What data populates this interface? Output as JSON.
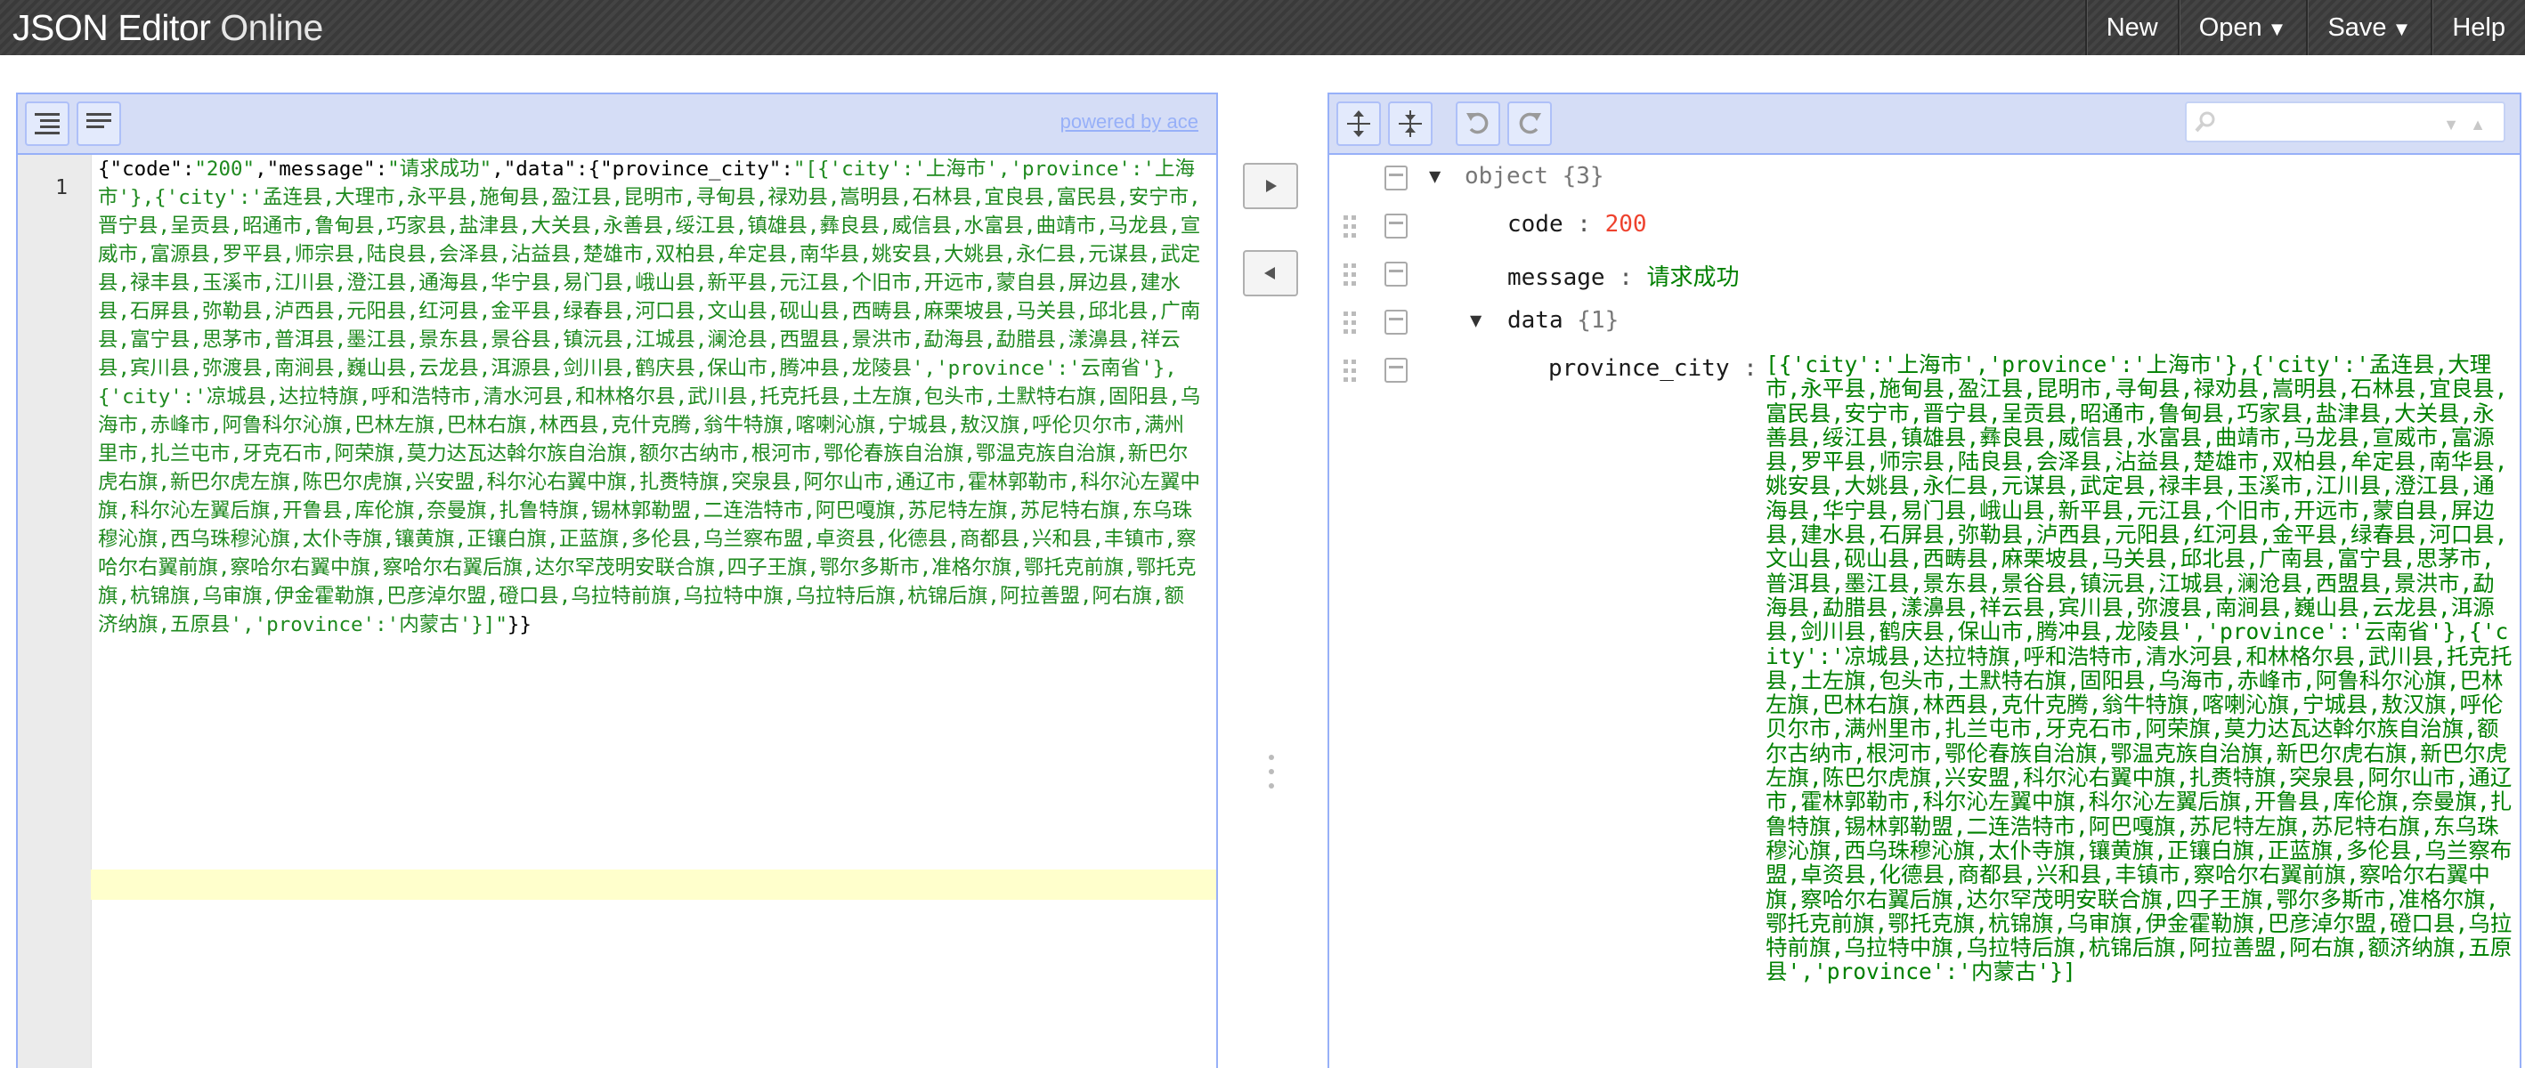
{
  "header": {
    "logo_bold": "JSON Editor",
    "logo_light": "Online",
    "menu": [
      {
        "label": "New",
        "caret": ""
      },
      {
        "label": "Open",
        "caret": "▼"
      },
      {
        "label": "Save",
        "caret": "▼"
      },
      {
        "label": "Help",
        "caret": ""
      }
    ]
  },
  "code_panel": {
    "powered_by": "powered by ace",
    "line_number": "1",
    "code": {
      "t01": "{",
      "t02": "\"code\"",
      "t03": ":",
      "t04": "\"200\"",
      "t05": ",",
      "t06": "\"message\"",
      "t07": ":",
      "t08": "\"请求成功\"",
      "t09": ",",
      "t10": "\"data\"",
      "t11": ":{",
      "t12": "\"province_city\"",
      "t13": ":",
      "t14": "\"[{'city':'上海市','province':'上海市'},{'city':'孟连县,大理市,永平县,施甸县,盈江县,昆明市,寻甸县,禄劝县,嵩明县,石林县,宜良县,富民县,安宁市,晋宁县,呈贡县,昭通市,鲁甸县,巧家县,盐津县,大关县,永善县,绥江县,镇雄县,彝良县,威信县,水富县,曲靖市,马龙县,宣威市,富源县,罗平县,师宗县,陆良县,会泽县,沾益县,楚雄市,双柏县,牟定县,南华县,姚安县,大姚县,永仁县,元谋县,武定县,禄丰县,玉溪市,江川县,澄江县,通海县,华宁县,易门县,峨山县,新平县,元江县,个旧市,开远市,蒙自县,屏边县,建水县,石屏县,弥勒县,泸西县,元阳县,红河县,金平县,绿春县,河口县,文山县,砚山县,西畴县,麻栗坡县,马关县,邱北县,广南县,富宁县,思茅市,普洱县,墨江县,景东县,景谷县,镇沅县,江城县,澜沧县,西盟县,景洪市,勐海县,勐腊县,漾濞县,祥云县,宾川县,弥渡县,南涧县,巍山县,云龙县,洱源县,剑川县,鹤庆县,保山市,腾冲县,龙陵县','province':'云南省'},{'city':'凉城县,达拉特旗,呼和浩特市,清水河县,和林格尔县,武川县,托克托县,土左旗,包头市,土默特右旗,固阳县,乌海市,赤峰市,阿鲁科尔沁旗,巴林左旗,巴林右旗,林西县,克什克腾,翁牛特旗,喀喇沁旗,宁城县,敖汉旗,呼伦贝尔市,满州里市,扎兰屯市,牙克石市,阿荣旗,莫力达瓦达斡尔族自治旗,额尔古纳市,根河市,鄂伦春族自治旗,鄂温克族自治旗,新巴尔虎右旗,新巴尔虎左旗,陈巴尔虎旗,兴安盟,科尔沁右翼中旗,扎赉特旗,突泉县,阿尔山市,通辽市,霍林郭勒市,科尔沁左翼中旗,科尔沁左翼后旗,开鲁县,库伦旗,奈曼旗,扎鲁特旗,锡林郭勒盟,二连浩特市,阿巴嘎旗,苏尼特左旗,苏尼特右旗,东乌珠穆沁旗,西乌珠穆沁旗,太仆寺旗,镶黄旗,正镶白旗,正蓝旗,多伦县,乌兰察布盟,卓资县,化德县,商都县,兴和县,丰镇市,察哈尔右翼前旗,察哈尔右翼中旗,察哈尔右翼后旗,达尔罕茂明安联合旗,四子王旗,鄂尔多斯市,准格尔旗,鄂托克前旗,鄂托克旗,杭锦旗,乌审旗,伊金霍勒旗,巴彦淖尔盟,磴口县,乌拉特前旗,乌拉特中旗,乌拉特后旗,杭锦后旗,阿拉善盟,阿右旗,额济纳旗,五原县','province':'内蒙古'}]\"",
      "t15": "}}"
    }
  },
  "tree_panel": {
    "root_label": "object",
    "root_count": "{3}",
    "fields": {
      "code_key": "code",
      "code_value": "200",
      "message_key": "message",
      "message_value": "请求成功",
      "data_key": "data",
      "data_count": "{1}",
      "pc_key": "province_city",
      "pc_value": "[{'city':'上海市','province':'上海市'},{'city':'孟连县,大理市,永平县,施甸县,盈江县,昆明市,寻甸县,禄劝县,嵩明县,石林县,宜良县,富民县,安宁市,晋宁县,呈贡县,昭通市,鲁甸县,巧家县,盐津县,大关县,永善县,绥江县,镇雄县,彝良县,威信县,水富县,曲靖市,马龙县,宣威市,富源县,罗平县,师宗县,陆良县,会泽县,沾益县,楚雄市,双柏县,牟定县,南华县,姚安县,大姚县,永仁县,元谋县,武定县,禄丰县,玉溪市,江川县,澄江县,通海县,华宁县,易门县,峨山县,新平县,元江县,个旧市,开远市,蒙自县,屏边县,建水县,石屏县,弥勒县,泸西县,元阳县,红河县,金平县,绿春县,河口县,文山县,砚山县,西畴县,麻栗坡县,马关县,邱北县,广南县,富宁县,思茅市,普洱县,墨江县,景东县,景谷县,镇沅县,江城县,澜沧县,西盟县,景洪市,勐海县,勐腊县,漾濞县,祥云县,宾川县,弥渡县,南涧县,巍山县,云龙县,洱源县,剑川县,鹤庆县,保山市,腾冲县,龙陵县','province':'云南省'},{'city':'凉城县,达拉特旗,呼和浩特市,清水河县,和林格尔县,武川县,托克托县,土左旗,包头市,土默特右旗,固阳县,乌海市,赤峰市,阿鲁科尔沁旗,巴林左旗,巴林右旗,林西县,克什克腾,翁牛特旗,喀喇沁旗,宁城县,敖汉旗,呼伦贝尔市,满州里市,扎兰屯市,牙克石市,阿荣旗,莫力达瓦达斡尔族自治旗,额尔古纳市,根河市,鄂伦春族自治旗,鄂温克族自治旗,新巴尔虎右旗,新巴尔虎左旗,陈巴尔虎旗,兴安盟,科尔沁右翼中旗,扎赉特旗,突泉县,阿尔山市,通辽市,霍林郭勒市,科尔沁左翼中旗,科尔沁左翼后旗,开鲁县,库伦旗,奈曼旗,扎鲁特旗,锡林郭勒盟,二连浩特市,阿巴嘎旗,苏尼特左旗,苏尼特右旗,东乌珠穆沁旗,西乌珠穆沁旗,太仆寺旗,镶黄旗,正镶白旗,正蓝旗,多伦县,乌兰察布盟,卓资县,化德县,商都县,兴和县,丰镇市,察哈尔右翼前旗,察哈尔右翼中旗,察哈尔右翼后旗,达尔罕茂明安联合旗,四子王旗,鄂尔多斯市,准格尔旗,鄂托克前旗,鄂托克旗,杭锦旗,乌审旗,伊金霍勒旗,巴彦淖尔盟,磴口县,乌拉特前旗,乌拉特中旗,乌拉特后旗,杭锦后旗,阿拉善盟,阿右旗,额济纳旗,五原县','province':'内蒙古'}]"
    },
    "separator": ":"
  },
  "icons": {
    "format": "format-icon",
    "compact": "compact-icon",
    "expand_all": "expand-all-icon",
    "collapse_all": "collapse-all-icon",
    "undo": "undo-icon",
    "redo": "redo-icon",
    "copy_right": "arrow-right-icon",
    "copy_left": "arrow-left-icon",
    "search": "search-icon"
  },
  "colors": {
    "panel_border": "#97b0f8",
    "toolbar_bg": "#d5ddf6",
    "string": "#008000",
    "number": "#ee422e"
  }
}
